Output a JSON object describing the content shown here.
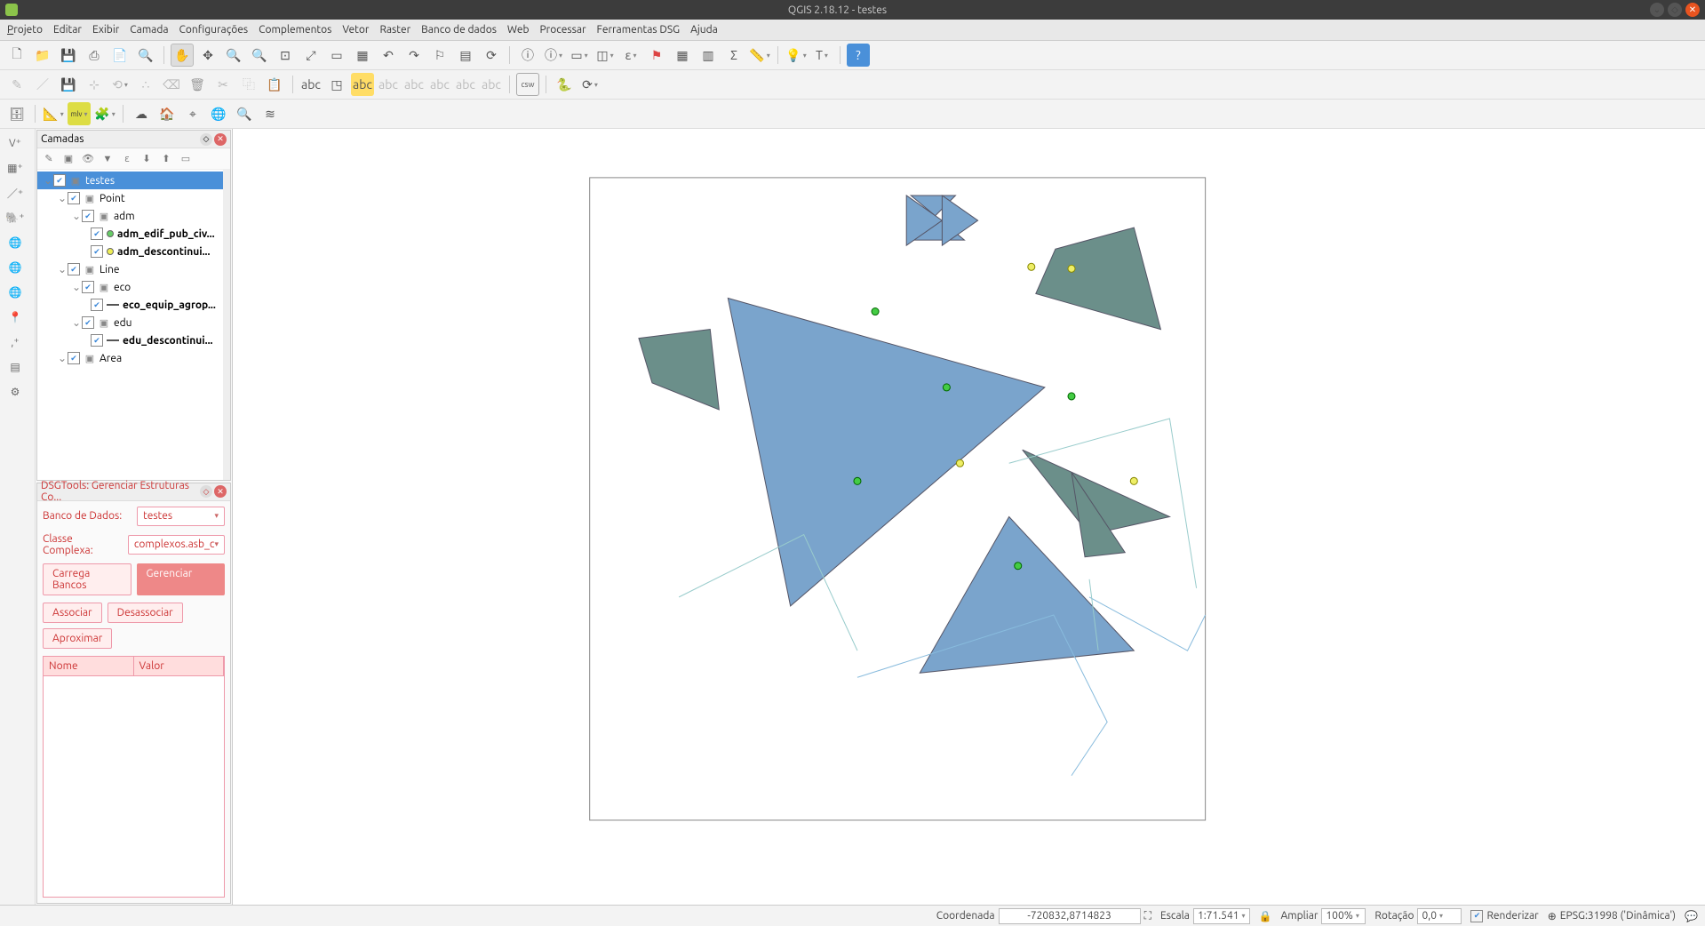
{
  "window": {
    "title": "QGIS 2.18.12 - testes"
  },
  "menu": {
    "projeto": "Projeto",
    "editar": "Editar",
    "exibir": "Exibir",
    "camada": "Camada",
    "configuracoes": "Configurações",
    "complementos": "Complementos",
    "vetor": "Vetor",
    "raster": "Raster",
    "banco": "Banco de dados",
    "web": "Web",
    "processar": "Processar",
    "ferramentasdsg": "Ferramentas DSG",
    "ajuda": "Ajuda"
  },
  "layers_panel": {
    "title": "Camadas",
    "root": "testes",
    "groups": {
      "point": "Point",
      "adm": "adm",
      "adm_edif": "adm_edif_pub_civ...",
      "adm_desc": "adm_descontinui...",
      "line": "Line",
      "eco": "eco",
      "eco_equip": "eco_equip_agrop...",
      "edu": "edu",
      "edu_desc": "edu_descontinui...",
      "area": "Area"
    }
  },
  "dsg_panel": {
    "title": "DSGTools: Gerenciar Estruturas Co...",
    "db_label": "Banco de Dados:",
    "db_value": "testes",
    "class_label": "Classe Complexa:",
    "class_value": "complexos.asb_c",
    "btn_load": "Carrega Bancos",
    "btn_manage": "Gerenciar",
    "btn_assoc": "Associar",
    "btn_desassoc": "Desassociar",
    "btn_aprox": "Aproximar",
    "col_nome": "Nome",
    "col_valor": "Valor"
  },
  "status": {
    "coord_label": "Coordenada",
    "coord_value": "-720832,8714823",
    "escala_label": "Escala",
    "escala_value": "1:71.541",
    "ampliar_label": "Ampliar",
    "ampliar_value": "100%",
    "rotacao_label": "Rotação",
    "rotacao_value": "0,0",
    "render_label": "Renderizar",
    "epsg": "EPSG:31998 ('Dinâmica')"
  },
  "toolbar_icons": {
    "new": "🗋",
    "open": "📂",
    "save": "💾",
    "saveas": "⎘",
    "print": "🖶",
    "zoom_layer": "🔍",
    "pan": "✋",
    "pan_sel": "✥",
    "zoomin": "🔍+",
    "zoomout": "🔍-",
    "zoomfull": "⤢",
    "zoomsel": "▭",
    "zoomlast": "↶",
    "zoomnext": "↷",
    "refresh": "⟳",
    "identify": "ⓘ",
    "measure": "📏",
    "attr_table": "▦",
    "calc": "Σ",
    "tips": "💡",
    "label": "T",
    "help": "?",
    "python": "🐍",
    "csw": "csw",
    "globe": "🌐",
    "home": "🏠",
    "target": "⌖",
    "osm": "☁"
  }
}
